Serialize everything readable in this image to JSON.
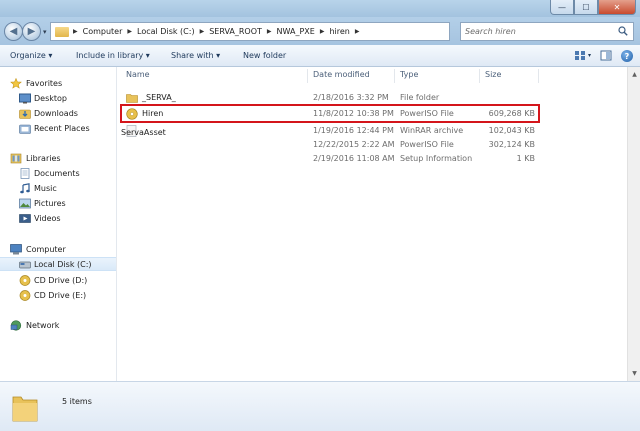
{
  "window": {
    "minimize": "—",
    "maximize": "☐",
    "close": "✕"
  },
  "address": {
    "crumbs": [
      "Computer",
      "Local Disk (C:)",
      "SERVA_ROOT",
      "NWA_PXE",
      "hiren"
    ],
    "search_placeholder": "Search hiren"
  },
  "toolbar": {
    "organize": "Organize ▾",
    "include": "Include in library ▾",
    "share": "Share with ▾",
    "new_folder": "New folder"
  },
  "nav": {
    "favorites": "Favorites",
    "desktop": "Desktop",
    "downloads": "Downloads",
    "recent": "Recent Places",
    "libraries": "Libraries",
    "documents": "Documents",
    "music": "Music",
    "pictures": "Pictures",
    "videos": "Videos",
    "computer": "Computer",
    "local_disk": "Local Disk (C:)",
    "cd_d": "CD Drive (D:)",
    "cd_e": "CD Drive (E:)",
    "network": "Network"
  },
  "columns": {
    "name": "Name",
    "date": "Date modified",
    "type": "Type",
    "size": "Size"
  },
  "files": [
    {
      "name": "_SERVA_",
      "date": "2/18/2016 3:32 PM",
      "type": "File folder",
      "size": "",
      "icon": "folder-icon"
    },
    {
      "name": "Hiren",
      "date": "11/8/2012 10:38 PM",
      "type": "PowerISO File",
      "size": "609,268 KB",
      "icon": "iso-icon"
    },
    {
      "name": "ServaAsset",
      "date": "1/19/2016 12:44 PM",
      "type": "WinRAR archive",
      "size": "102,043 KB",
      "icon": "file-icon"
    },
    {
      "name": "",
      "date": "12/22/2015 2:22 AM",
      "type": "PowerISO File",
      "size": "302,124 KB",
      "icon": "file-icon"
    },
    {
      "name": "",
      "date": "2/19/2016 11:08 AM",
      "type": "Setup Information",
      "size": "1 KB",
      "icon": "file-icon"
    }
  ],
  "status": {
    "items": "5 items"
  },
  "colors": {
    "highlight": "#d4151b",
    "folder": "#e8c25a"
  }
}
